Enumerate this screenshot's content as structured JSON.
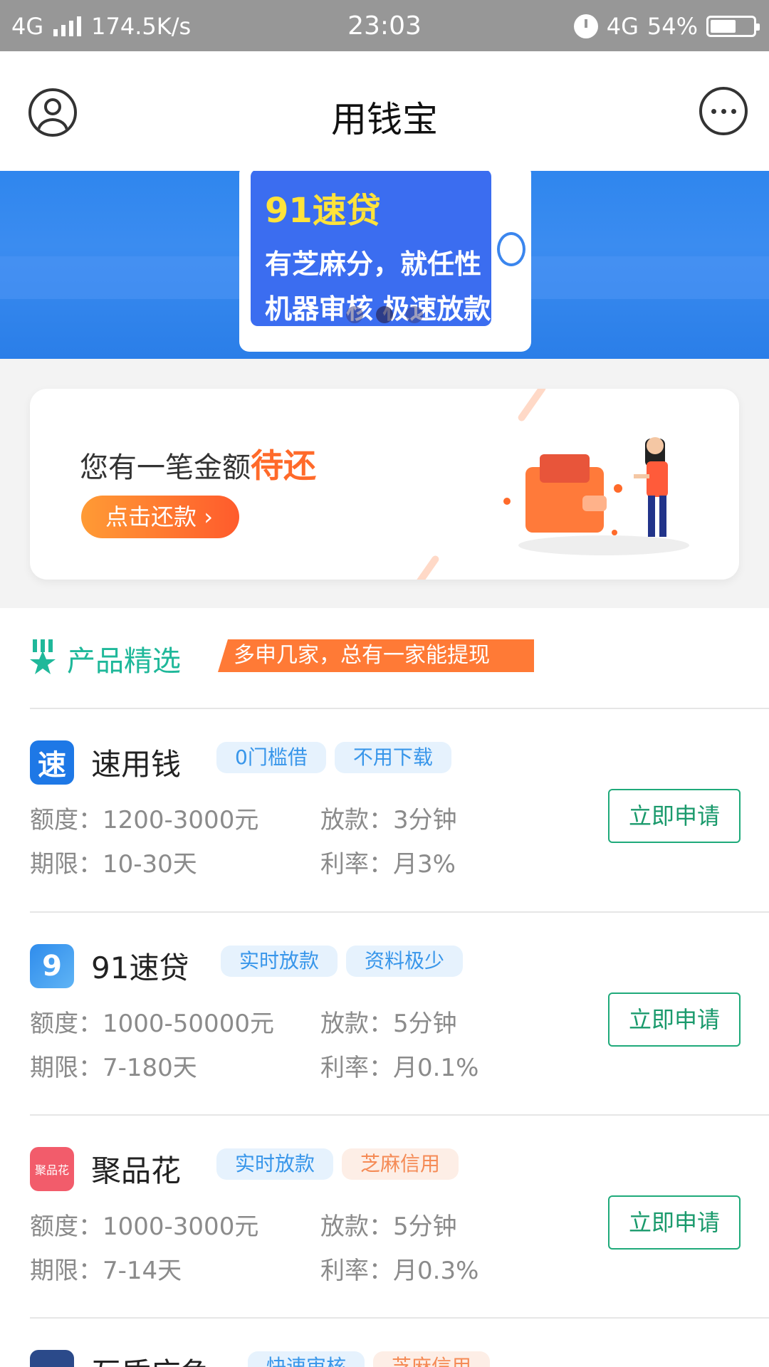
{
  "status_bar": {
    "network": "4G",
    "speed": "174.5K/s",
    "time": "23:03",
    "network_right": "4G",
    "battery": "54%"
  },
  "header": {
    "title": "用钱宝"
  },
  "banner": {
    "brand": "91速贷",
    "line1": "有芝麻分，就任性",
    "line2": "机器审核 极速放款",
    "active_dot": 2,
    "dot_count": 3
  },
  "repay_card": {
    "message": "您有一笔金额",
    "highlight": "待还",
    "button": "点击还款",
    "button_arrow": "›"
  },
  "section": {
    "title": "产品精选",
    "slogan": "多申几家，总有一家能提现"
  },
  "products": [
    {
      "name": "速用钱",
      "logo_text": "速",
      "logo_color": "#1e78e6",
      "tags": [
        {
          "text": "0门槛借",
          "style": "blue"
        },
        {
          "text": "不用下载",
          "style": "blue"
        }
      ],
      "amount_label": "额度：",
      "amount": "1200-3000元",
      "release_label": "放款：",
      "release": "3分钟",
      "term_label": "期限：",
      "term": "10-30天",
      "rate_label": "利率：",
      "rate": "月3%",
      "apply": "立即申请"
    },
    {
      "name": "91速贷",
      "logo_text": "9",
      "logo_color": "#2f8cec",
      "tags": [
        {
          "text": "实时放款",
          "style": "blue"
        },
        {
          "text": "资料极少",
          "style": "blue"
        }
      ],
      "amount_label": "额度：",
      "amount": "1000-50000元",
      "release_label": "放款：",
      "release": "5分钟",
      "term_label": "期限：",
      "term": "7-180天",
      "rate_label": "利率：",
      "rate": "月0.1%",
      "apply": "立即申请"
    },
    {
      "name": "聚品花",
      "logo_text": "聚品花",
      "logo_color": "#f25c6b",
      "tags": [
        {
          "text": "实时放款",
          "style": "blue"
        },
        {
          "text": "芝麻信用",
          "style": "orange"
        }
      ],
      "amount_label": "额度：",
      "amount": "1000-3000元",
      "release_label": "放款：",
      "release": "5分钟",
      "term_label": "期限：",
      "term": "7-14天",
      "rate_label": "利率：",
      "rate": "月0.3%",
      "apply": "立即申请"
    },
    {
      "name": "互质应急",
      "logo_text": "",
      "logo_color": "#2b4a8a",
      "tags": [
        {
          "text": "快速审核",
          "style": "blue"
        },
        {
          "text": "芝麻信用",
          "style": "orange"
        }
      ]
    }
  ],
  "colors": {
    "accent_green": "#1fb89a",
    "accent_orange": "#ff6a2a",
    "banner_blue": "#2f86ee"
  }
}
